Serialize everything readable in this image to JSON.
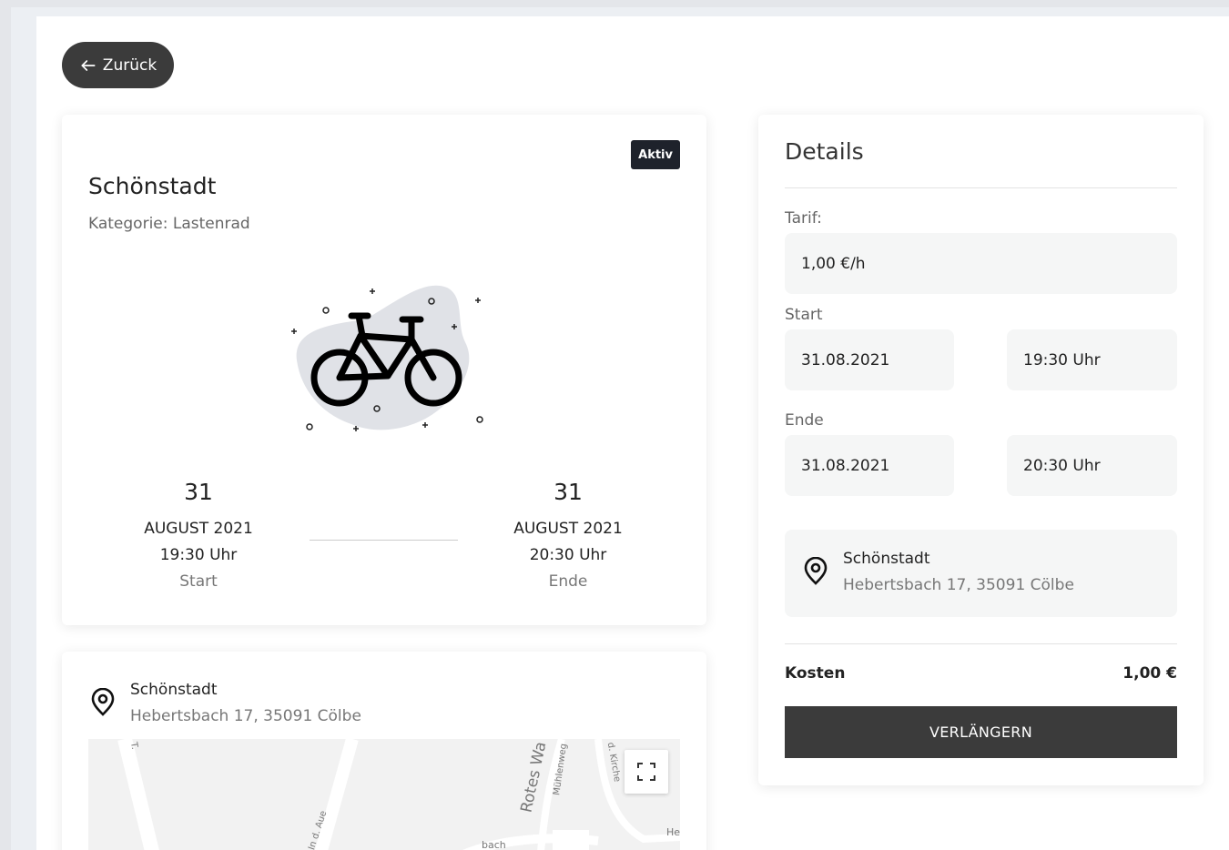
{
  "header": {
    "back_label": "Zurück"
  },
  "booking": {
    "status": "Aktiv",
    "station": "Schönstadt",
    "category": "Kategorie: Lastenrad",
    "start": {
      "day": "31",
      "month_year": "AUGUST 2021",
      "time": "19:30 Uhr",
      "label": "Start"
    },
    "end": {
      "day": "31",
      "month_year": "AUGUST 2021",
      "time": "20:30 Uhr",
      "label": "Ende"
    }
  },
  "location": {
    "name": "Schönstadt",
    "address": "Hebertsbach 17, 35091 Cölbe"
  },
  "map": {
    "labels": [
      "Rotes Wa",
      "Mühlenweg",
      "d. Kirche",
      "In d. Aue",
      "bach",
      "He",
      "T."
    ]
  },
  "details": {
    "title": "Details",
    "tariff_label": "Tarif:",
    "tariff_value": "1,00 €/h",
    "start_label": "Start",
    "start_date": "31.08.2021",
    "start_time": "19:30 Uhr",
    "end_label": "Ende",
    "end_date": "31.08.2021",
    "end_time": "20:30 Uhr",
    "cost_label": "Kosten",
    "cost_value": "1,00 €",
    "extend_label": "VERLÄNGERN"
  },
  "colors": {
    "dark": "#3b3b3b",
    "badge": "#1e222b",
    "field_bg": "#f5f6f6"
  }
}
